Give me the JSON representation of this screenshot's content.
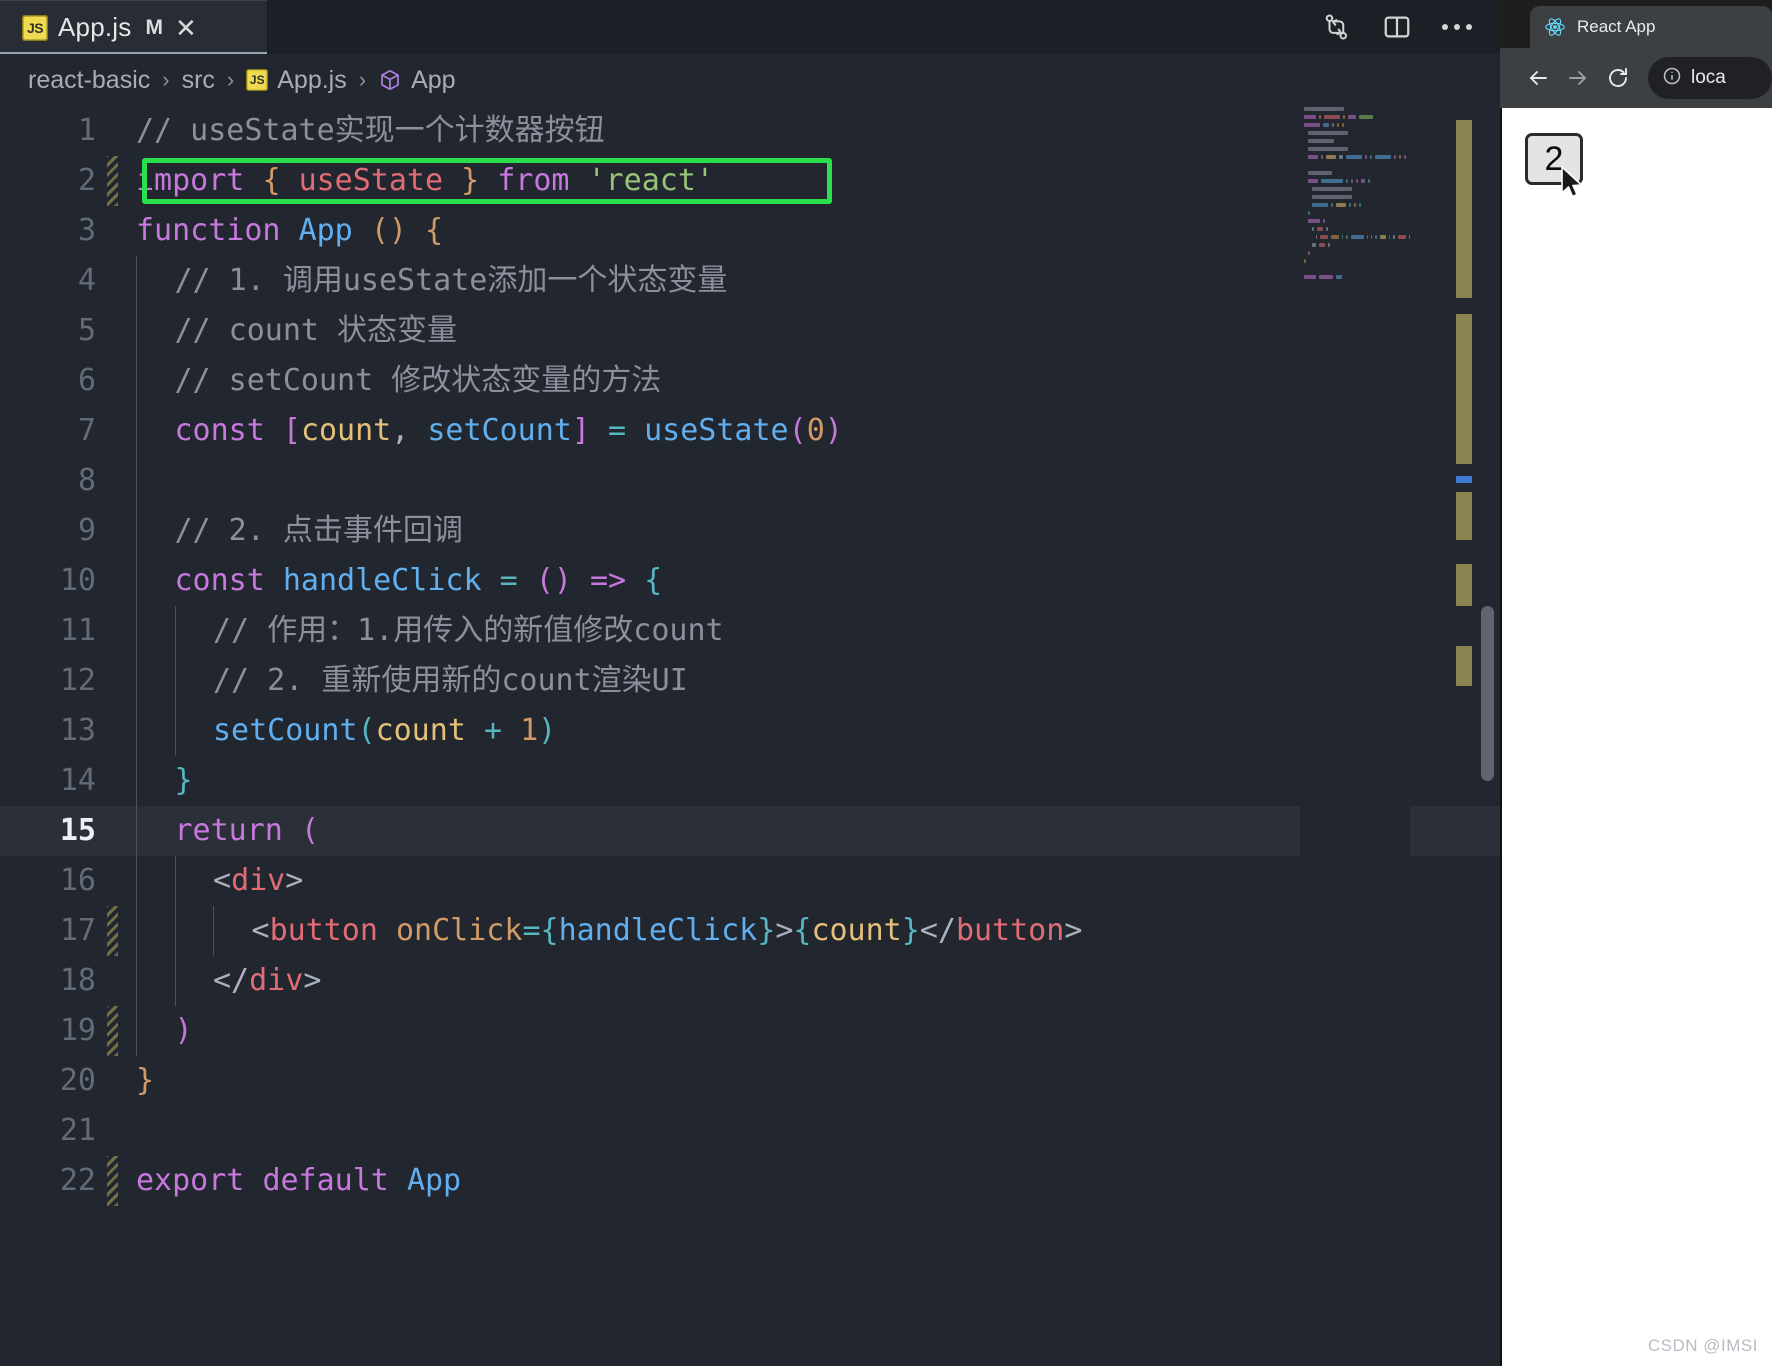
{
  "editor": {
    "tab": {
      "filename": "App.js",
      "modified_badge": "M",
      "close_label": "✕",
      "file_icon": "JS"
    },
    "actions": {
      "compare_icon": "source-control-compare-icon",
      "split_icon": "split-editor-icon",
      "more_label": "more-actions-icon"
    },
    "breadcrumb": {
      "project": "react-basic",
      "folder": "src",
      "file": "App.js",
      "symbol": "App",
      "separator": "›",
      "file_icon": "JS"
    },
    "active_line": 15,
    "highlight_box_line": 2,
    "highlight_box_color": "#2ae04a",
    "lines": [
      {
        "n": 1,
        "modified": false,
        "indent": 0,
        "tokens": [
          {
            "t": "// useState实现一个计数器按钮",
            "c": "t-cmt"
          }
        ]
      },
      {
        "n": 2,
        "modified": true,
        "indent": 0,
        "tokens": [
          {
            "t": "import",
            "c": "t-kw"
          },
          {
            "t": " ",
            "c": "t-punct"
          },
          {
            "t": "{",
            "c": "t-br1"
          },
          {
            "t": " ",
            "c": "t-punct"
          },
          {
            "t": "useState",
            "c": "t-tag"
          },
          {
            "t": " ",
            "c": "t-punct"
          },
          {
            "t": "}",
            "c": "t-br1"
          },
          {
            "t": " ",
            "c": "t-punct"
          },
          {
            "t": "from",
            "c": "t-kw"
          },
          {
            "t": " ",
            "c": "t-punct"
          },
          {
            "t": "'react'",
            "c": "t-str"
          }
        ]
      },
      {
        "n": 3,
        "modified": false,
        "indent": 0,
        "tokens": [
          {
            "t": "function",
            "c": "t-kw"
          },
          {
            "t": " ",
            "c": "t-punct"
          },
          {
            "t": "App",
            "c": "t-fn"
          },
          {
            "t": " ",
            "c": "t-punct"
          },
          {
            "t": "(",
            "c": "t-br1"
          },
          {
            "t": ")",
            "c": "t-br1"
          },
          {
            "t": " ",
            "c": "t-punct"
          },
          {
            "t": "{",
            "c": "t-br1"
          }
        ]
      },
      {
        "n": 4,
        "modified": false,
        "indent": 1,
        "tokens": [
          {
            "t": "// 1. 调用useState添加一个状态变量",
            "c": "t-cmt"
          }
        ]
      },
      {
        "n": 5,
        "modified": false,
        "indent": 1,
        "tokens": [
          {
            "t": "// count 状态变量",
            "c": "t-cmt"
          }
        ]
      },
      {
        "n": 6,
        "modified": false,
        "indent": 1,
        "tokens": [
          {
            "t": "// setCount 修改状态变量的方法",
            "c": "t-cmt"
          }
        ]
      },
      {
        "n": 7,
        "modified": false,
        "indent": 1,
        "tokens": [
          {
            "t": "const",
            "c": "t-kw"
          },
          {
            "t": " ",
            "c": "t-punct"
          },
          {
            "t": "[",
            "c": "t-br2"
          },
          {
            "t": "count",
            "c": "t-var"
          },
          {
            "t": ", ",
            "c": "t-punct"
          },
          {
            "t": "setCount",
            "c": "t-fn"
          },
          {
            "t": "]",
            "c": "t-br2"
          },
          {
            "t": " ",
            "c": "t-punct"
          },
          {
            "t": "=",
            "c": "t-op"
          },
          {
            "t": " ",
            "c": "t-punct"
          },
          {
            "t": "useState",
            "c": "t-fn"
          },
          {
            "t": "(",
            "c": "t-br2"
          },
          {
            "t": "0",
            "c": "t-num"
          },
          {
            "t": ")",
            "c": "t-br2"
          }
        ]
      },
      {
        "n": 8,
        "modified": false,
        "indent": 1,
        "tokens": []
      },
      {
        "n": 9,
        "modified": false,
        "indent": 1,
        "tokens": [
          {
            "t": "// 2. 点击事件回调",
            "c": "t-cmt"
          }
        ]
      },
      {
        "n": 10,
        "modified": false,
        "indent": 1,
        "tokens": [
          {
            "t": "const",
            "c": "t-kw"
          },
          {
            "t": " ",
            "c": "t-punct"
          },
          {
            "t": "handleClick",
            "c": "t-fn"
          },
          {
            "t": " ",
            "c": "t-punct"
          },
          {
            "t": "=",
            "c": "t-op"
          },
          {
            "t": " ",
            "c": "t-punct"
          },
          {
            "t": "(",
            "c": "t-br2"
          },
          {
            "t": ")",
            "c": "t-br2"
          },
          {
            "t": " ",
            "c": "t-punct"
          },
          {
            "t": "=>",
            "c": "t-kw"
          },
          {
            "t": " ",
            "c": "t-punct"
          },
          {
            "t": "{",
            "c": "t-br3"
          }
        ]
      },
      {
        "n": 11,
        "modified": false,
        "indent": 2,
        "tokens": [
          {
            "t": "// 作用：1.用传入的新值修改count",
            "c": "t-cmt"
          }
        ]
      },
      {
        "n": 12,
        "modified": false,
        "indent": 2,
        "tokens": [
          {
            "t": "// 2. 重新使用新的count渲染UI",
            "c": "t-cmt"
          }
        ]
      },
      {
        "n": 13,
        "modified": false,
        "indent": 2,
        "tokens": [
          {
            "t": "setCount",
            "c": "t-fn"
          },
          {
            "t": "(",
            "c": "t-br3"
          },
          {
            "t": "count",
            "c": "t-var"
          },
          {
            "t": " ",
            "c": "t-punct"
          },
          {
            "t": "+",
            "c": "t-op"
          },
          {
            "t": " ",
            "c": "t-punct"
          },
          {
            "t": "1",
            "c": "t-num"
          },
          {
            "t": ")",
            "c": "t-br3"
          }
        ]
      },
      {
        "n": 14,
        "modified": false,
        "indent": 1,
        "tokens": [
          {
            "t": "}",
            "c": "t-br3"
          }
        ]
      },
      {
        "n": 15,
        "modified": false,
        "indent": 1,
        "tokens": [
          {
            "t": "return",
            "c": "t-kw"
          },
          {
            "t": " ",
            "c": "t-punct"
          },
          {
            "t": "(",
            "c": "t-br2"
          }
        ]
      },
      {
        "n": 16,
        "modified": false,
        "indent": 2,
        "tokens": [
          {
            "t": "<",
            "c": "t-punct"
          },
          {
            "t": "div",
            "c": "t-tag"
          },
          {
            "t": ">",
            "c": "t-punct"
          }
        ]
      },
      {
        "n": 17,
        "modified": true,
        "indent": 3,
        "tokens": [
          {
            "t": "<",
            "c": "t-punct"
          },
          {
            "t": "button",
            "c": "t-tag"
          },
          {
            "t": " ",
            "c": "t-punct"
          },
          {
            "t": "onClick",
            "c": "t-attr"
          },
          {
            "t": "=",
            "c": "t-op"
          },
          {
            "t": "{",
            "c": "t-br3"
          },
          {
            "t": "handleClick",
            "c": "t-fn"
          },
          {
            "t": "}",
            "c": "t-br3"
          },
          {
            "t": ">",
            "c": "t-punct"
          },
          {
            "t": "{",
            "c": "t-br3"
          },
          {
            "t": "count",
            "c": "t-var"
          },
          {
            "t": "}",
            "c": "t-br3"
          },
          {
            "t": "</",
            "c": "t-punct"
          },
          {
            "t": "button",
            "c": "t-tag"
          },
          {
            "t": ">",
            "c": "t-punct"
          }
        ]
      },
      {
        "n": 18,
        "modified": false,
        "indent": 2,
        "tokens": [
          {
            "t": "</",
            "c": "t-punct"
          },
          {
            "t": "div",
            "c": "t-tag"
          },
          {
            "t": ">",
            "c": "t-punct"
          }
        ]
      },
      {
        "n": 19,
        "modified": true,
        "indent": 1,
        "tokens": [
          {
            "t": ")",
            "c": "t-br2"
          }
        ]
      },
      {
        "n": 20,
        "modified": false,
        "indent": 0,
        "tokens": [
          {
            "t": "}",
            "c": "t-br1"
          }
        ]
      },
      {
        "n": 21,
        "modified": false,
        "indent": 0,
        "tokens": []
      },
      {
        "n": 22,
        "modified": true,
        "indent": 0,
        "tokens": [
          {
            "t": "export",
            "c": "t-kw"
          },
          {
            "t": " ",
            "c": "t-punct"
          },
          {
            "t": "default",
            "c": "t-kw"
          },
          {
            "t": " ",
            "c": "t-punct"
          },
          {
            "t": "App",
            "c": "t-fn"
          }
        ]
      }
    ]
  },
  "browser": {
    "tab_title": "React App",
    "tab_icon": "react-logo-icon",
    "back_label": "←",
    "forward_label": "→",
    "reload_label": "↻",
    "site_info_icon": "site-info-icon",
    "url_text": "loca",
    "page": {
      "counter_button_label": "2"
    }
  },
  "watermark": "CSDN @IMSI",
  "colors": {
    "editor_bg": "#22262e",
    "tabbar_bg": "#1b1f26",
    "active_tab_bg": "#282c34",
    "highlight_green": "#2ae04a",
    "cursor_line": "#2b2f38",
    "browser_chrome": "#3c4043"
  }
}
